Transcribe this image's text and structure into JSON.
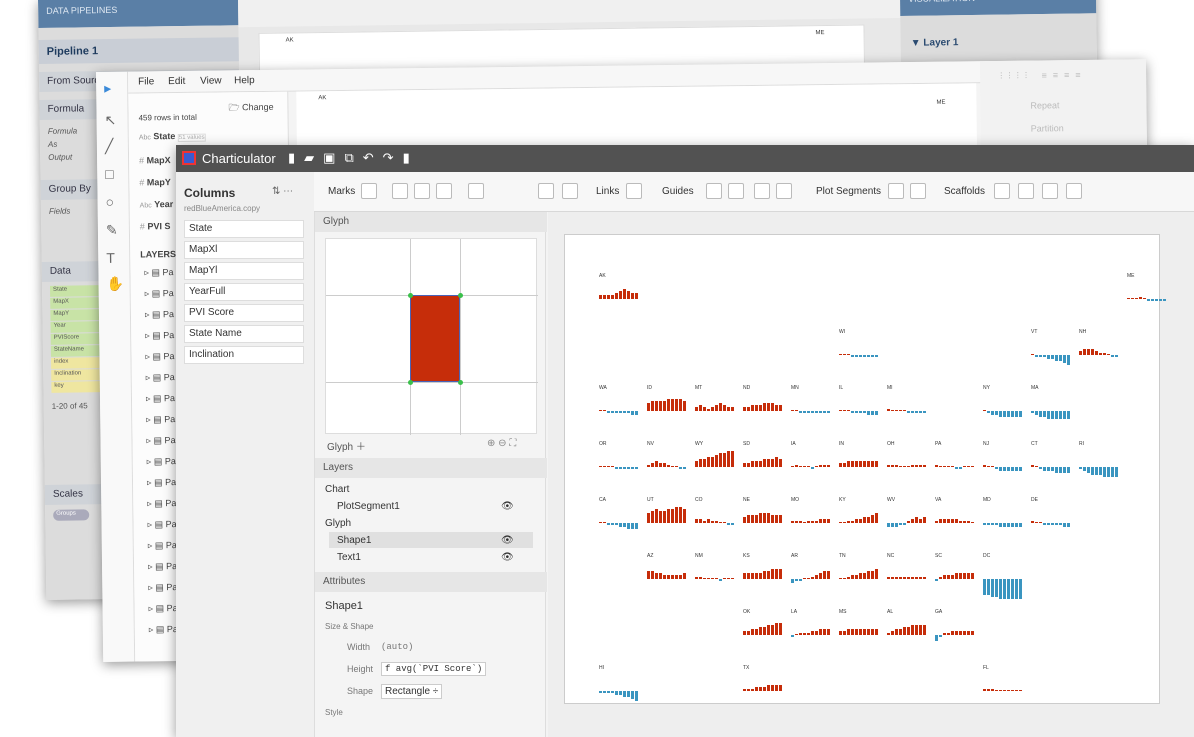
{
  "w1": {
    "left_header": "DATA PIPELINES",
    "pipeline": "Pipeline 1",
    "from_source": "From Sourc",
    "formula_section": "Formula",
    "formula_rows": [
      "Formula",
      "As",
      "Output"
    ],
    "groupby": "Group By",
    "fields": "Fields",
    "data": "Data",
    "data_items": [
      "State",
      "MapX",
      "MapY",
      "Year",
      "PVIScore",
      "StateName",
      "index",
      "Inclination",
      "key"
    ],
    "paging": "1-20 of 45",
    "scales": "Scales",
    "groups": "Groups",
    "right_header": "VISUALIZATION",
    "layer": "▼ Layer 1",
    "ak": "AK",
    "me": "ME"
  },
  "w2": {
    "menu": [
      "File",
      "Edit",
      "View",
      "Help"
    ],
    "rows_total": "459 rows in total",
    "change": "Change",
    "fields": [
      {
        "type": "Abc",
        "name": "State",
        "extra": "51 values"
      },
      {
        "type": "#",
        "name": "MapX"
      },
      {
        "type": "#",
        "name": "MapY"
      },
      {
        "type": "Abc",
        "name": "Year"
      },
      {
        "type": "#",
        "name": "PVI S"
      }
    ],
    "layers": "LAYERS",
    "layer_item": "Pa",
    "ak": "AK",
    "me": "ME",
    "repeat": "Repeat",
    "partition": "Partition"
  },
  "w3": {
    "title": "Charticulator",
    "columns": {
      "header": "Columns",
      "dataset": "redBlueAmerica.copy",
      "items": [
        "State",
        "MapXl",
        "MapYl",
        "YearFull",
        "PVI Score",
        "State Name",
        "Inclination"
      ]
    },
    "toolbar": {
      "marks": "Marks",
      "links": "Links",
      "guides": "Guides",
      "plot_segments": "Plot Segments",
      "scaffolds": "Scaffolds"
    },
    "glyph_panel": "Glyph",
    "glyph_tab": "Glyph",
    "layers_panel": "Layers",
    "layers": {
      "chart": "Chart",
      "plot": "PlotSegment1",
      "glyph": "Glyph",
      "shape": "Shape1",
      "text": "Text1"
    },
    "attributes_panel": "Attributes",
    "attr": {
      "object": "Shape1",
      "section": "Size & Shape",
      "width_label": "Width",
      "width_value": "(auto)",
      "height_label": "Height",
      "height_value": "f avg(`PVI Score`)",
      "shape_label": "Shape",
      "shape_value": "Rectangle ÷",
      "style": "Style"
    },
    "colors": {
      "red": "#c62d0a",
      "blue": "#3a95c0",
      "titlebar": "#525252"
    }
  },
  "states": [
    {
      "code": "AK",
      "col": 0,
      "row": 0,
      "s": [
        2,
        2,
        2,
        2,
        3,
        4,
        5,
        4,
        3,
        3
      ]
    },
    {
      "code": "ME",
      "col": 11,
      "row": 0,
      "s": [
        0,
        0,
        0,
        1,
        0,
        -1,
        -1,
        -1,
        -1,
        -1
      ]
    },
    {
      "code": "WI",
      "col": 5,
      "row": 1,
      "s": [
        0,
        0,
        0,
        -1,
        -1,
        -1,
        -1,
        -1,
        -1,
        -1
      ]
    },
    {
      "code": "VT",
      "col": 9,
      "row": 1,
      "s": [
        0,
        -1,
        -1,
        -1,
        -2,
        -2,
        -3,
        -3,
        -4,
        -5
      ]
    },
    {
      "code": "NH",
      "col": 10,
      "row": 1,
      "s": [
        2,
        3,
        3,
        3,
        2,
        1,
        1,
        0,
        -1,
        -1
      ]
    },
    {
      "code": "WA",
      "col": 0,
      "row": 2,
      "s": [
        0,
        0,
        -1,
        -1,
        -1,
        -1,
        -1,
        -1,
        -2,
        -2
      ]
    },
    {
      "code": "ID",
      "col": 1,
      "row": 2,
      "s": [
        4,
        5,
        5,
        5,
        5,
        6,
        6,
        6,
        6,
        5
      ]
    },
    {
      "code": "MT",
      "col": 2,
      "row": 2,
      "s": [
        2,
        3,
        2,
        1,
        2,
        3,
        4,
        3,
        2,
        2
      ]
    },
    {
      "code": "ND",
      "col": 3,
      "row": 2,
      "s": [
        2,
        2,
        3,
        3,
        3,
        4,
        4,
        4,
        3,
        3
      ]
    },
    {
      "code": "MN",
      "col": 4,
      "row": 2,
      "s": [
        0,
        0,
        -1,
        -1,
        -1,
        -1,
        -1,
        -1,
        -1,
        -1
      ]
    },
    {
      "code": "IL",
      "col": 5,
      "row": 2,
      "s": [
        0,
        0,
        0,
        -1,
        -1,
        -1,
        -1,
        -2,
        -2,
        -2
      ]
    },
    {
      "code": "MI",
      "col": 6,
      "row": 2,
      "s": [
        1,
        0,
        0,
        0,
        0,
        -1,
        -1,
        -1,
        -1,
        -1
      ]
    },
    {
      "code": "NY",
      "col": 8,
      "row": 2,
      "s": [
        0,
        -1,
        -2,
        -2,
        -3,
        -3,
        -3,
        -3,
        -3,
        -3
      ]
    },
    {
      "code": "MA",
      "col": 9,
      "row": 2,
      "s": [
        -1,
        -2,
        -3,
        -3,
        -4,
        -4,
        -4,
        -4,
        -4,
        -4
      ]
    },
    {
      "code": "OR",
      "col": 0,
      "row": 3,
      "s": [
        0,
        0,
        0,
        0,
        -1,
        -1,
        -1,
        -1,
        -1,
        -1
      ]
    },
    {
      "code": "NV",
      "col": 1,
      "row": 3,
      "s": [
        1,
        2,
        3,
        2,
        2,
        1,
        0,
        0,
        -1,
        -1
      ]
    },
    {
      "code": "WY",
      "col": 2,
      "row": 3,
      "s": [
        3,
        4,
        4,
        5,
        5,
        6,
        7,
        7,
        8,
        8
      ]
    },
    {
      "code": "SD",
      "col": 3,
      "row": 3,
      "s": [
        2,
        2,
        3,
        3,
        3,
        4,
        4,
        4,
        5,
        4
      ]
    },
    {
      "code": "IA",
      "col": 4,
      "row": 3,
      "s": [
        0,
        1,
        0,
        0,
        0,
        -1,
        0,
        1,
        1,
        1
      ]
    },
    {
      "code": "IN",
      "col": 5,
      "row": 3,
      "s": [
        2,
        2,
        3,
        3,
        3,
        3,
        3,
        3,
        3,
        3
      ]
    },
    {
      "code": "OH",
      "col": 6,
      "row": 3,
      "s": [
        1,
        1,
        1,
        0,
        0,
        0,
        1,
        1,
        1,
        1
      ]
    },
    {
      "code": "PA",
      "col": 7,
      "row": 3,
      "s": [
        1,
        0,
        0,
        0,
        0,
        -1,
        -1,
        0,
        0,
        0
      ]
    },
    {
      "code": "NJ",
      "col": 8,
      "row": 3,
      "s": [
        1,
        0,
        0,
        -1,
        -2,
        -2,
        -2,
        -2,
        -2,
        -2
      ]
    },
    {
      "code": "CT",
      "col": 9,
      "row": 3,
      "s": [
        1,
        0,
        -1,
        -2,
        -2,
        -2,
        -3,
        -3,
        -3,
        -3
      ]
    },
    {
      "code": "RI",
      "col": 10,
      "row": 3,
      "s": [
        -1,
        -2,
        -3,
        -4,
        -4,
        -4,
        -5,
        -5,
        -5,
        -5
      ]
    },
    {
      "code": "CA",
      "col": 0,
      "row": 4,
      "s": [
        0,
        0,
        -1,
        -1,
        -1,
        -2,
        -2,
        -3,
        -3,
        -3
      ]
    },
    {
      "code": "UT",
      "col": 1,
      "row": 4,
      "s": [
        5,
        6,
        7,
        6,
        6,
        7,
        7,
        8,
        8,
        7
      ]
    },
    {
      "code": "CO",
      "col": 2,
      "row": 4,
      "s": [
        2,
        2,
        1,
        2,
        1,
        1,
        0,
        0,
        -1,
        -1
      ]
    },
    {
      "code": "NE",
      "col": 3,
      "row": 4,
      "s": [
        3,
        4,
        4,
        4,
        5,
        5,
        5,
        4,
        4,
        4
      ]
    },
    {
      "code": "MO",
      "col": 4,
      "row": 4,
      "s": [
        1,
        1,
        1,
        0,
        1,
        1,
        1,
        2,
        2,
        2
      ]
    },
    {
      "code": "KY",
      "col": 5,
      "row": 4,
      "s": [
        0,
        0,
        1,
        1,
        2,
        2,
        3,
        3,
        4,
        5
      ]
    },
    {
      "code": "WV",
      "col": 6,
      "row": 4,
      "s": [
        -2,
        -2,
        -2,
        -1,
        -1,
        1,
        2,
        3,
        2,
        3
      ]
    },
    {
      "code": "VA",
      "col": 7,
      "row": 4,
      "s": [
        1,
        2,
        2,
        2,
        2,
        2,
        1,
        1,
        1,
        0
      ]
    },
    {
      "code": "MD",
      "col": 8,
      "row": 4,
      "s": [
        -1,
        -1,
        -1,
        -1,
        -2,
        -2,
        -2,
        -2,
        -2,
        -2
      ]
    },
    {
      "code": "DE",
      "col": 9,
      "row": 4,
      "s": [
        1,
        0,
        0,
        -1,
        -1,
        -1,
        -1,
        -1,
        -2,
        -2
      ]
    },
    {
      "code": "AZ",
      "col": 1,
      "row": 5,
      "s": [
        4,
        4,
        3,
        3,
        2,
        2,
        2,
        2,
        2,
        3
      ]
    },
    {
      "code": "NM",
      "col": 2,
      "row": 5,
      "s": [
        1,
        1,
        0,
        0,
        0,
        0,
        -1,
        0,
        0,
        0
      ]
    },
    {
      "code": "KS",
      "col": 3,
      "row": 5,
      "s": [
        3,
        3,
        3,
        3,
        3,
        4,
        4,
        5,
        5,
        5
      ]
    },
    {
      "code": "AR",
      "col": 4,
      "row": 5,
      "s": [
        -2,
        -1,
        -1,
        0,
        0,
        1,
        2,
        3,
        4,
        4
      ]
    },
    {
      "code": "TN",
      "col": 5,
      "row": 5,
      "s": [
        0,
        0,
        1,
        2,
        2,
        3,
        3,
        4,
        4,
        5
      ]
    },
    {
      "code": "NC",
      "col": 6,
      "row": 5,
      "s": [
        1,
        1,
        1,
        1,
        1,
        1,
        1,
        1,
        1,
        1
      ]
    },
    {
      "code": "SC",
      "col": 7,
      "row": 5,
      "s": [
        -1,
        1,
        2,
        2,
        2,
        3,
        3,
        3,
        3,
        3
      ]
    },
    {
      "code": "DC",
      "col": 8,
      "row": 5,
      "s": [
        -8,
        -8,
        -9,
        -9,
        -10,
        -10,
        -10,
        -10,
        -10,
        -10
      ]
    },
    {
      "code": "OK",
      "col": 3,
      "row": 6,
      "s": [
        2,
        2,
        3,
        3,
        4,
        4,
        5,
        5,
        6,
        6
      ]
    },
    {
      "code": "LA",
      "col": 4,
      "row": 6,
      "s": [
        -1,
        0,
        1,
        1,
        1,
        2,
        2,
        3,
        3,
        3
      ]
    },
    {
      "code": "MS",
      "col": 5,
      "row": 6,
      "s": [
        2,
        2,
        3,
        3,
        3,
        3,
        3,
        3,
        3,
        3
      ]
    },
    {
      "code": "AL",
      "col": 6,
      "row": 6,
      "s": [
        1,
        2,
        3,
        3,
        4,
        4,
        5,
        5,
        5,
        5
      ]
    },
    {
      "code": "GA",
      "col": 7,
      "row": 6,
      "s": [
        -3,
        -1,
        1,
        1,
        2,
        2,
        2,
        2,
        2,
        2
      ]
    },
    {
      "code": "HI",
      "col": 0,
      "row": 7,
      "s": [
        -1,
        -1,
        -1,
        -1,
        -2,
        -2,
        -3,
        -3,
        -4,
        -5
      ]
    },
    {
      "code": "TX",
      "col": 3,
      "row": 7,
      "s": [
        1,
        1,
        1,
        2,
        2,
        2,
        3,
        3,
        3,
        3
      ]
    },
    {
      "code": "FL",
      "col": 8,
      "row": 7,
      "s": [
        1,
        1,
        1,
        0,
        0,
        0,
        0,
        0,
        0,
        0
      ]
    }
  ]
}
